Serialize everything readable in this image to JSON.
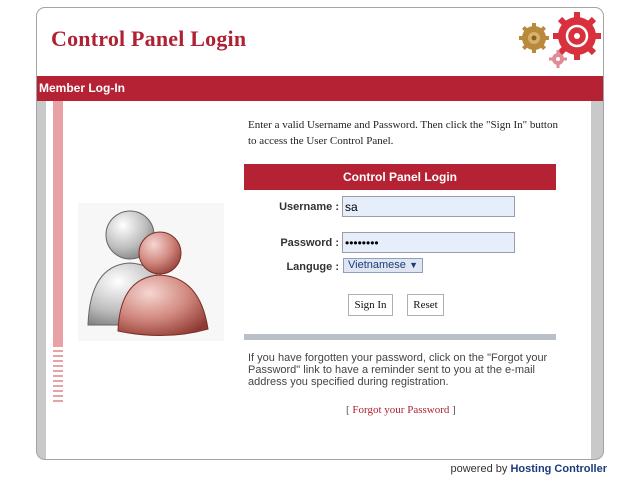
{
  "header": {
    "title": "Control Panel Login"
  },
  "bar": {
    "title": "Member Log-In"
  },
  "instructions": "Enter a valid Username and Password. Then click the \"Sign In\" button to access the User Control Panel.",
  "login_panel": {
    "title": "Control Panel Login",
    "username_label": "Username :",
    "username_value": "sa",
    "password_label": "Password :",
    "password_value": "••••••••",
    "language_label": "Langugе :",
    "language_selected": "Vietnamese",
    "signin_label": "Sign In",
    "reset_label": "Reset"
  },
  "forgot": {
    "text": "If you have forgotten your password, click on the \"Forgot your Password\" link to have a reminder sent to you at the e-mail address you specified during registration.",
    "bracket_open": "[",
    "link_label": "Forgot your Password",
    "bracket_close": "]"
  },
  "footer": {
    "prefix": "powered by",
    "brand": "Hosting Controller"
  },
  "colors": {
    "accent": "#b52234",
    "title": "#ae2233"
  }
}
